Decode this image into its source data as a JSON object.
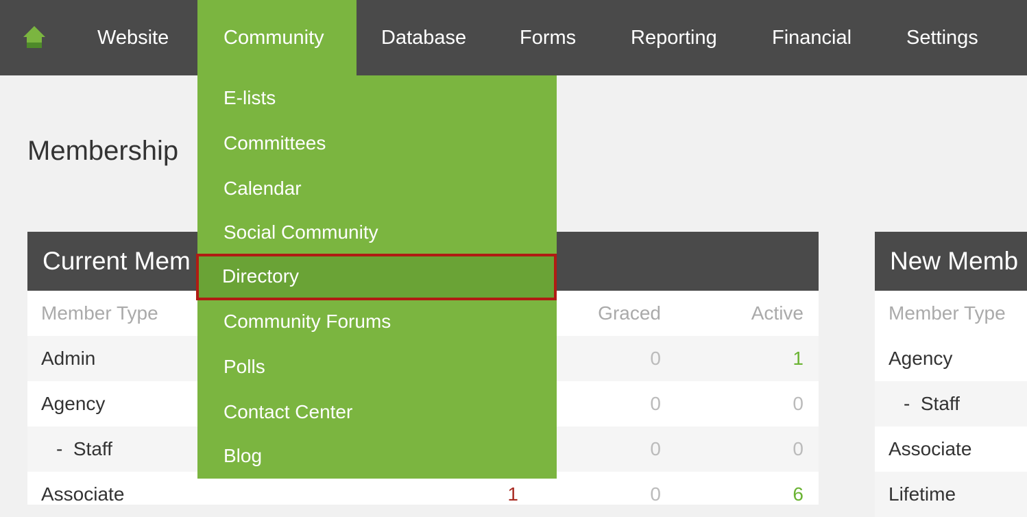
{
  "nav": {
    "items": [
      "Website",
      "Community",
      "Database",
      "Forms",
      "Reporting",
      "Financial",
      "Settings"
    ],
    "active": "Community",
    "accent_color": "#7bb540"
  },
  "dropdown": {
    "items": [
      "E-lists",
      "Committees",
      "Calendar",
      "Social Community",
      "Directory",
      "Community Forums",
      "Polls",
      "Contact Center",
      "Blog"
    ],
    "highlighted": "Directory"
  },
  "page": {
    "title": "Membership"
  },
  "current_panel": {
    "title": "Current Mem",
    "columns": {
      "member_type": "Member Type",
      "graced": "Graced",
      "active": "Active"
    },
    "rows": [
      {
        "type": "Admin",
        "graced": "0",
        "active": "1"
      },
      {
        "type": "Agency",
        "graced": "0",
        "active": "0"
      },
      {
        "type": "-  Staff",
        "graced": "0",
        "active": "0"
      },
      {
        "type": "Associate",
        "expired": "1",
        "graced": "0",
        "active": "6"
      }
    ]
  },
  "new_panel": {
    "title": "New Memb",
    "columns": {
      "member_type": "Member Type"
    },
    "rows": [
      "Agency",
      "-  Staff",
      "Associate",
      "Lifetime"
    ]
  }
}
